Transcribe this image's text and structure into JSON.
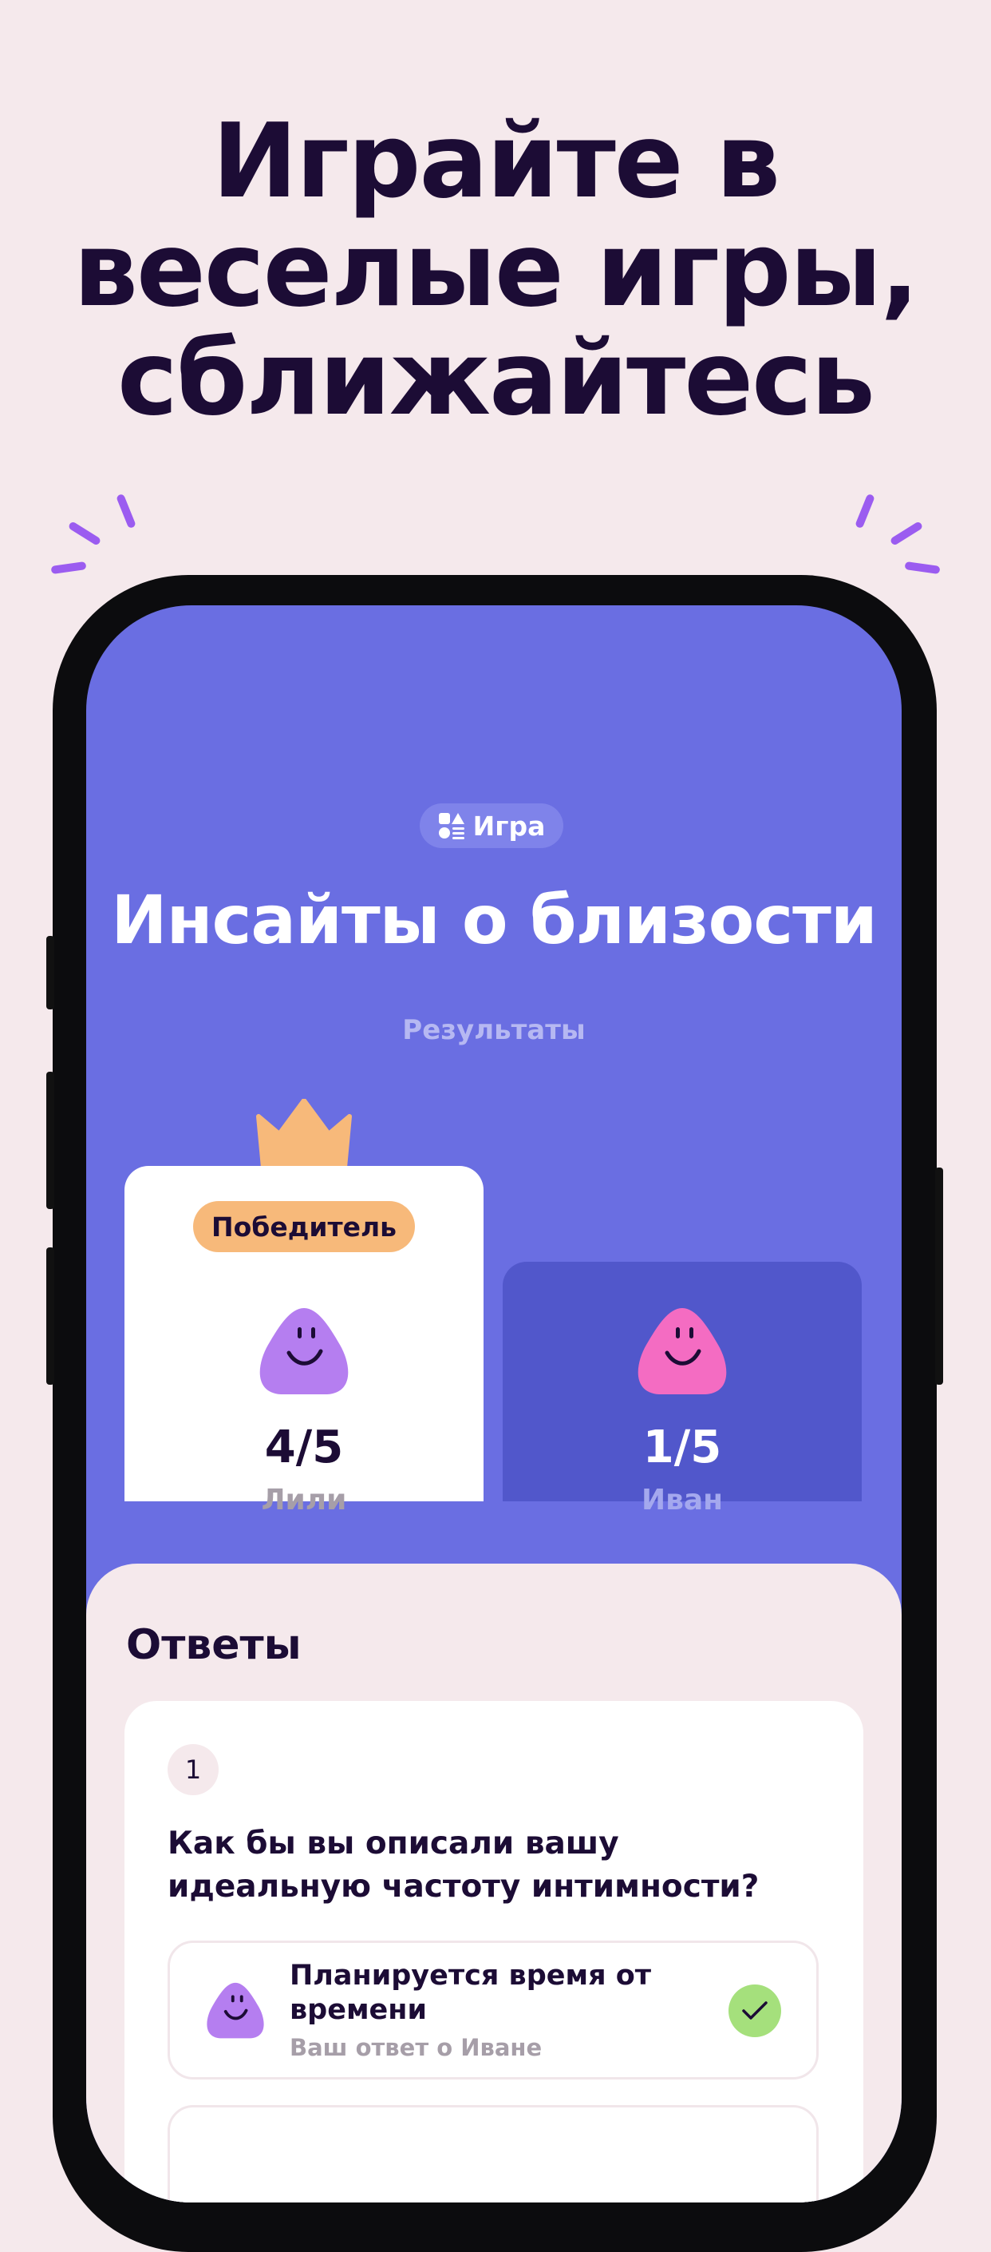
{
  "headline": [
    "Играйте в",
    "веселые игры,",
    "сближайтесь"
  ],
  "colors": {
    "background": "#f5e9ec",
    "screen": "#6a6ee2",
    "accent_purple": "#b57ef0",
    "accent_pink": "#f46cc2",
    "badge": "#f7b97a",
    "check": "#a5e07c"
  },
  "game": {
    "chip_label": "Игра",
    "chip_icon": "shapes-icon",
    "title": "Инсайты о близости",
    "subtitle": "Результаты"
  },
  "results": {
    "winner_label": "Победитель",
    "players": [
      {
        "score": "4/5",
        "name": "Лили",
        "avatar": "purple-blob-avatar"
      },
      {
        "score": "1/5",
        "name": "Иван",
        "avatar": "pink-blob-avatar"
      }
    ]
  },
  "answers": {
    "title": "Ответы",
    "questions": [
      {
        "number": "1",
        "text": "Как бы вы описали вашу идеальную частоту интимности?",
        "answer_title": "Планируется время от времени",
        "answer_sub": "Ваш ответ о Иване"
      }
    ]
  }
}
